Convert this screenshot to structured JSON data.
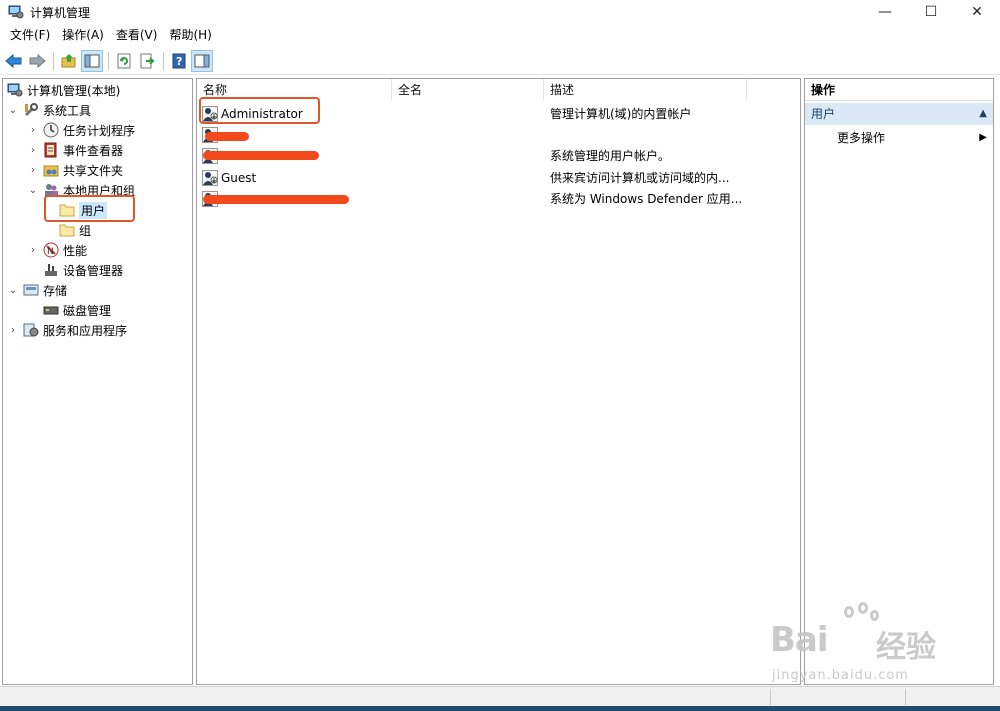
{
  "window": {
    "title": "计算机管理",
    "controls": {
      "minimize": "—",
      "maximize": "☐",
      "close": "✕"
    }
  },
  "menu": [
    "文件(F)",
    "操作(A)",
    "查看(V)",
    "帮助(H)"
  ],
  "toolbar": {
    "icons": [
      "back-icon",
      "forward-icon",
      "up-folder-icon",
      "show-hide-tree-icon",
      "refresh-icon",
      "export-list-icon",
      "help-icon",
      "action-pane-icon"
    ]
  },
  "tree": {
    "root": "计算机管理(本地)",
    "system_tools": "系统工具",
    "task_scheduler": "任务计划程序",
    "event_viewer": "事件查看器",
    "shared_folders": "共享文件夹",
    "local_users_groups": "本地用户和组",
    "users": "用户",
    "groups": "组",
    "performance": "性能",
    "device_manager": "设备管理器",
    "storage": "存储",
    "disk_management": "磁盘管理",
    "services_apps": "服务和应用程序"
  },
  "list": {
    "columns": [
      "名称",
      "全名",
      "描述"
    ],
    "rows": [
      {
        "name": "Administrator",
        "fullname": "",
        "description": "管理计算机(域)的内置帐户"
      },
      {
        "name": "",
        "fullname": "",
        "description": ""
      },
      {
        "name": "",
        "fullname": "",
        "description": "系统管理的用户帐户。"
      },
      {
        "name": "Guest",
        "fullname": "",
        "description": "供来宾访问计算机或访问域的内..."
      },
      {
        "name": "",
        "fullname": "",
        "description": "系统为 Windows Defender 应用..."
      }
    ]
  },
  "actions": {
    "header": "操作",
    "section": "用户",
    "more": "更多操作"
  },
  "watermark": {
    "brand": "Bai",
    "brand_cn": "经验",
    "url": "jingyan.baidu.com"
  },
  "colors": {
    "highlight": "#e2542b",
    "redaction": "#f24a1c",
    "selection": "#cce8ff",
    "action_section": "#dbe8f5"
  }
}
